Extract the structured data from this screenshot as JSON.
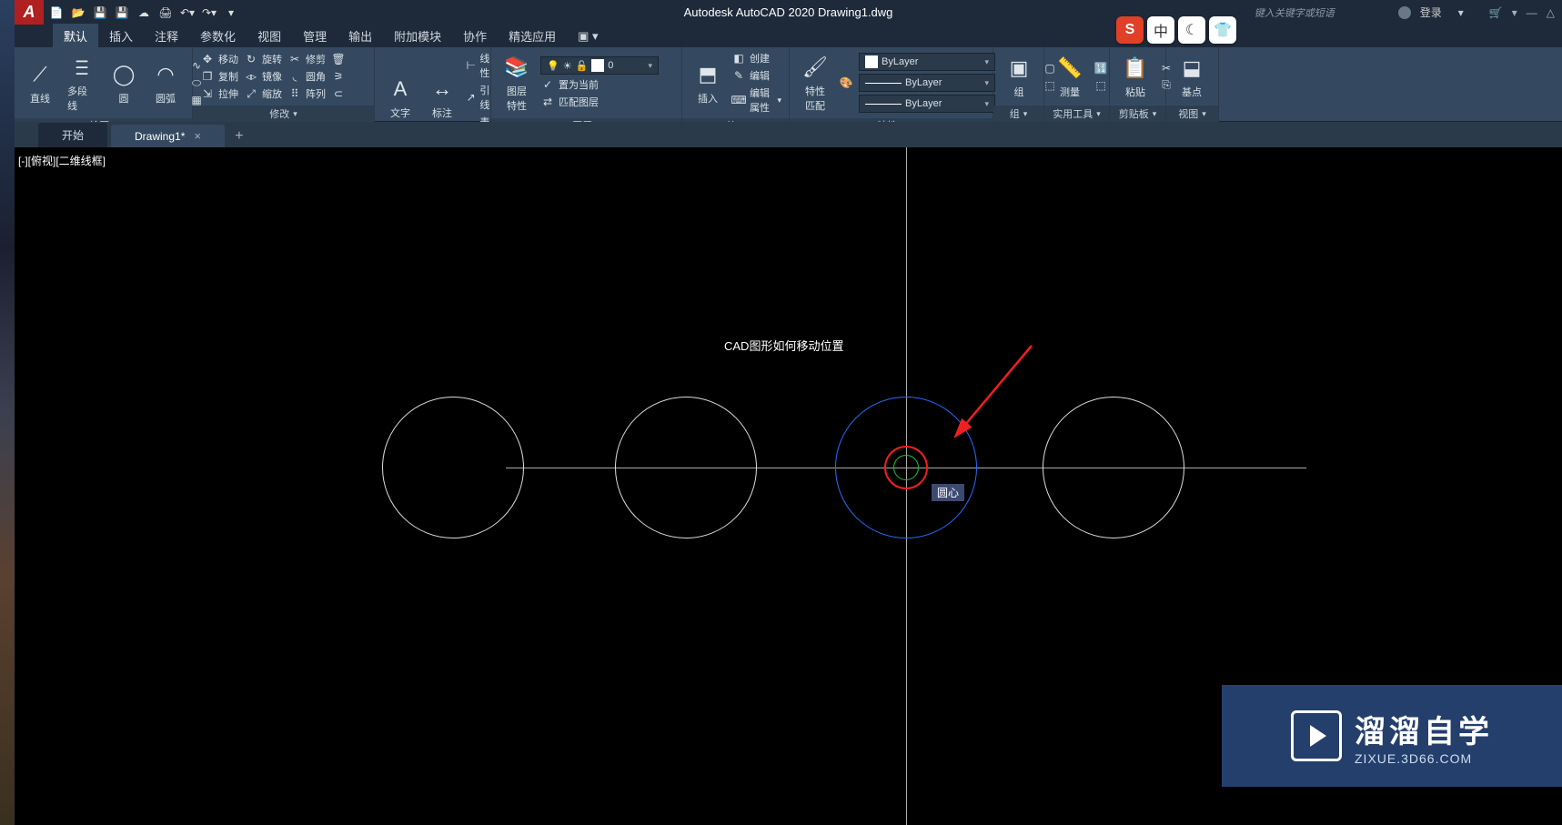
{
  "app": {
    "logo": "A",
    "title": "Autodesk AutoCAD 2020   Drawing1.dwg",
    "search_hint": "键入关键字或短语",
    "login": "登录"
  },
  "ime": {
    "s": "S",
    "zhong": "中",
    "moon": "☾",
    "shirt": "👕"
  },
  "tabs": {
    "items": [
      "默认",
      "插入",
      "注释",
      "参数化",
      "视图",
      "管理",
      "输出",
      "附加模块",
      "协作",
      "精选应用"
    ],
    "active": 0
  },
  "ribbon": {
    "draw": {
      "title": "绘图",
      "line": "直线",
      "polyline": "多段线",
      "circle": "圆",
      "arc": "圆弧"
    },
    "modify": {
      "title": "修改",
      "move": "移动",
      "copy": "复制",
      "stretch": "拉伸",
      "rotate": "旋转",
      "mirror": "镜像",
      "scale": "缩放",
      "trim": "修剪",
      "fillet": "圆角",
      "array": "阵列"
    },
    "annot": {
      "title": "注释",
      "text": "文字",
      "dim": "标注",
      "leader": "引线",
      "table": "表格",
      "linear": "线性"
    },
    "layers": {
      "title": "图层",
      "props": "图层\n特性",
      "cur_layer": "0",
      "setcur": "置为当前",
      "match": "匹配图层"
    },
    "block": {
      "title": "块",
      "insert": "插入",
      "create": "创建",
      "edit": "编辑",
      "editattr": "编辑属性"
    },
    "props": {
      "title": "特性",
      "match": "特性\n匹配",
      "bylayer": "ByLayer"
    },
    "group": {
      "title": "组",
      "group": "组"
    },
    "util": {
      "title": "实用工具",
      "measure": "测量"
    },
    "clip": {
      "title": "剪贴板",
      "paste": "粘贴"
    },
    "view": {
      "title": "视图",
      "base": "基点"
    }
  },
  "file_tabs": {
    "start": "开始",
    "drawing": "Drawing1*"
  },
  "canvas": {
    "vp": "[-][俯视][二维线框]",
    "anno": "CAD图形如何移动位置",
    "snap": "圆心"
  },
  "watermark": {
    "name": "溜溜自学",
    "url": "ZIXUE.3D66.COM"
  }
}
